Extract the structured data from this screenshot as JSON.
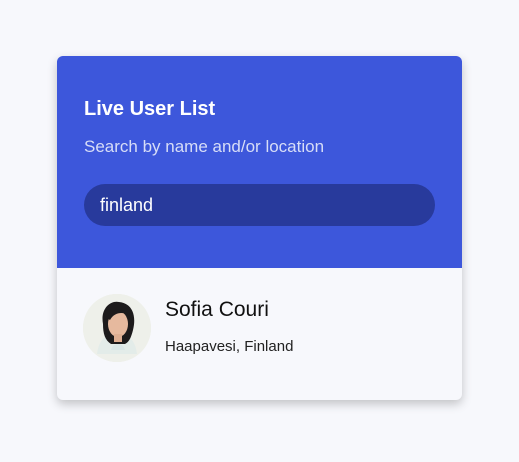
{
  "header": {
    "title": "Live User List",
    "subtitle": "Search by name and/or location"
  },
  "search": {
    "value": "finland"
  },
  "users": [
    {
      "name": "Sofia Couri",
      "location": "Haapavesi, Finland",
      "avatar_icon": "user-photo"
    }
  ],
  "colors": {
    "header_bg": "#3d57db",
    "search_bg": "#283a9c",
    "page_bg": "#f7f8fc"
  }
}
